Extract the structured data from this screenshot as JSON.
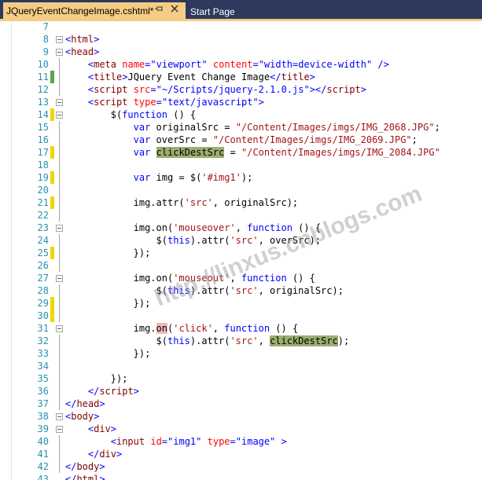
{
  "tabs": [
    {
      "label": "JQueryEventChangeImage.cshtml*",
      "active": true
    },
    {
      "label": "Start Page",
      "active": false
    }
  ],
  "icons": {
    "pin": "pin-icon",
    "close": "close-icon"
  },
  "colors": {
    "tab_bar": "#2d3a5e",
    "active_tab": "#f5cc84",
    "saved_marker": "#57a64a",
    "unsaved_marker": "#efd700",
    "highlight": "#9aaf6f"
  },
  "editor": {
    "lines": [
      {
        "n": "7"
      },
      {
        "n": "8"
      },
      {
        "n": "9"
      },
      {
        "n": "10"
      },
      {
        "n": "11"
      },
      {
        "n": "12"
      },
      {
        "n": "13"
      },
      {
        "n": "14"
      },
      {
        "n": "15"
      },
      {
        "n": "16"
      },
      {
        "n": "17"
      },
      {
        "n": "18"
      },
      {
        "n": "19"
      },
      {
        "n": "20"
      },
      {
        "n": "21"
      },
      {
        "n": "22"
      },
      {
        "n": "23"
      },
      {
        "n": "24"
      },
      {
        "n": "25"
      },
      {
        "n": "26"
      },
      {
        "n": "27"
      },
      {
        "n": "28"
      },
      {
        "n": "29"
      },
      {
        "n": "30"
      },
      {
        "n": "31"
      },
      {
        "n": "32"
      },
      {
        "n": "33"
      },
      {
        "n": "34"
      },
      {
        "n": "35"
      },
      {
        "n": "36"
      },
      {
        "n": "37"
      },
      {
        "n": "38"
      },
      {
        "n": "39"
      },
      {
        "n": "40"
      },
      {
        "n": "41"
      },
      {
        "n": "42"
      },
      {
        "n": "43"
      }
    ],
    "code": {
      "l8": [
        "<",
        "html",
        ">"
      ],
      "l9": [
        "<",
        "head",
        ">"
      ],
      "l10": [
        "<",
        "meta",
        " ",
        "name",
        "=",
        "\"viewport\"",
        " ",
        "content",
        "=",
        "\"width=device-width\"",
        " />"
      ],
      "l11": [
        "<",
        "title",
        ">",
        "JQuery Event Change Image",
        "</",
        "title",
        ">"
      ],
      "l12": [
        "<",
        "script",
        " ",
        "src",
        "=",
        "\"~/Scripts/jquery-2.1.0.js\"",
        "></",
        "script",
        ">"
      ],
      "l13": [
        "<",
        "script",
        " ",
        "type",
        "=",
        "\"text/javascript\"",
        ">"
      ],
      "l14": [
        "$(",
        "function",
        " () {"
      ],
      "l15": [
        "var",
        " originalSrc = ",
        "\"/Content/Images/imgs/IMG_2068.JPG\"",
        ";"
      ],
      "l16": [
        "var",
        " overSrc = ",
        "\"/Content/Images/imgs/IMG_2069.JPG\"",
        ";"
      ],
      "l17": [
        "var",
        " ",
        "clickDestSrc",
        " = ",
        "\"/Content/Images/imgs/IMG_2084.JPG\""
      ],
      "l19": [
        "var",
        " img = $(",
        "'#img1'",
        ");"
      ],
      "l21": [
        "img.attr(",
        "'src'",
        ", originalSrc);"
      ],
      "l23": [
        "img.on(",
        "'mouseover'",
        ", ",
        "function",
        " () {"
      ],
      "l24": [
        "$(",
        "this",
        ").attr(",
        "'src'",
        ", overSrc);"
      ],
      "l25": [
        "});"
      ],
      "l27": [
        "img.on(",
        "'mouseout'",
        ", ",
        "function",
        " () {"
      ],
      "l28": [
        "$(",
        "this",
        ").attr(",
        "'src'",
        ", originalSrc);"
      ],
      "l29": [
        "});"
      ],
      "l31": [
        "img.",
        "on",
        "(",
        "'click'",
        ", ",
        "function",
        " () {"
      ],
      "l32": [
        "$(",
        "this",
        ").attr(",
        "'src'",
        ", ",
        "clickDestSrc",
        ");"
      ],
      "l33": [
        "});"
      ],
      "l35": [
        "});"
      ],
      "l36": [
        "</",
        "script",
        ">"
      ],
      "l37": [
        "</",
        "head",
        ">"
      ],
      "l38": [
        "<",
        "body",
        ">"
      ],
      "l39": [
        "<",
        "div",
        ">"
      ],
      "l40": [
        "<",
        "input",
        " ",
        "id",
        "=",
        "\"img1\"",
        " ",
        "type",
        "=",
        "\"image\"",
        " >"
      ],
      "l41": [
        "</",
        "div",
        ">"
      ],
      "l42": [
        "</",
        "body",
        ">"
      ],
      "l43": [
        "</",
        "html",
        ">"
      ]
    }
  },
  "watermark": "http://linxus.cnblogs.com"
}
